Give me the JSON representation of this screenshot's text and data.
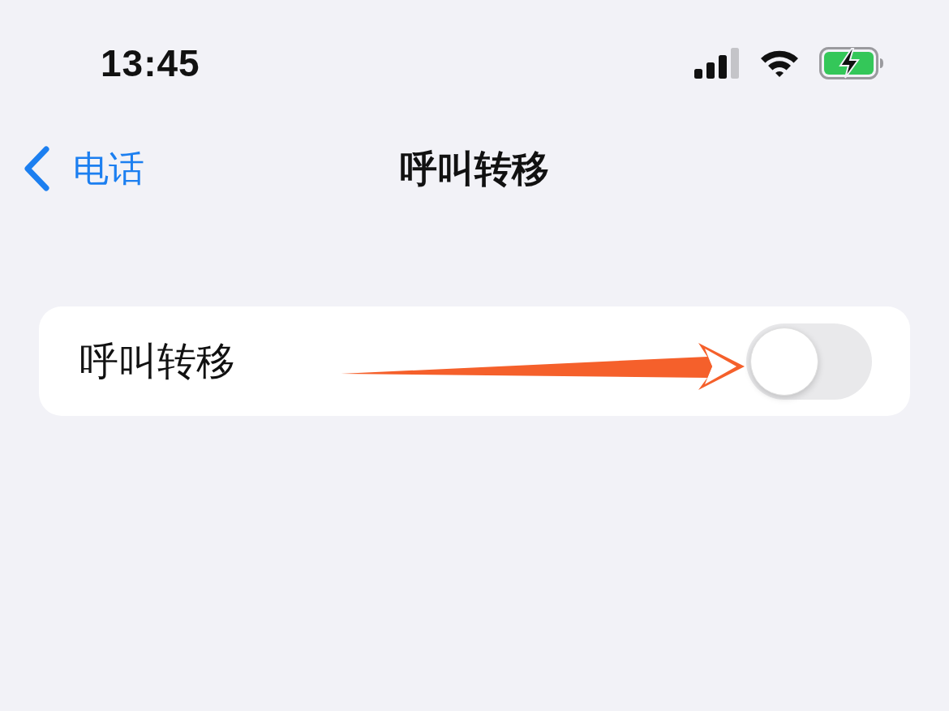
{
  "status_bar": {
    "time": "13:45",
    "battery": {
      "charging": true
    }
  },
  "nav_bar": {
    "back_label": "电话",
    "title": "呼叫转移"
  },
  "rows": [
    {
      "kind": "toggle",
      "label": "呼叫转移",
      "on": false
    }
  ]
}
